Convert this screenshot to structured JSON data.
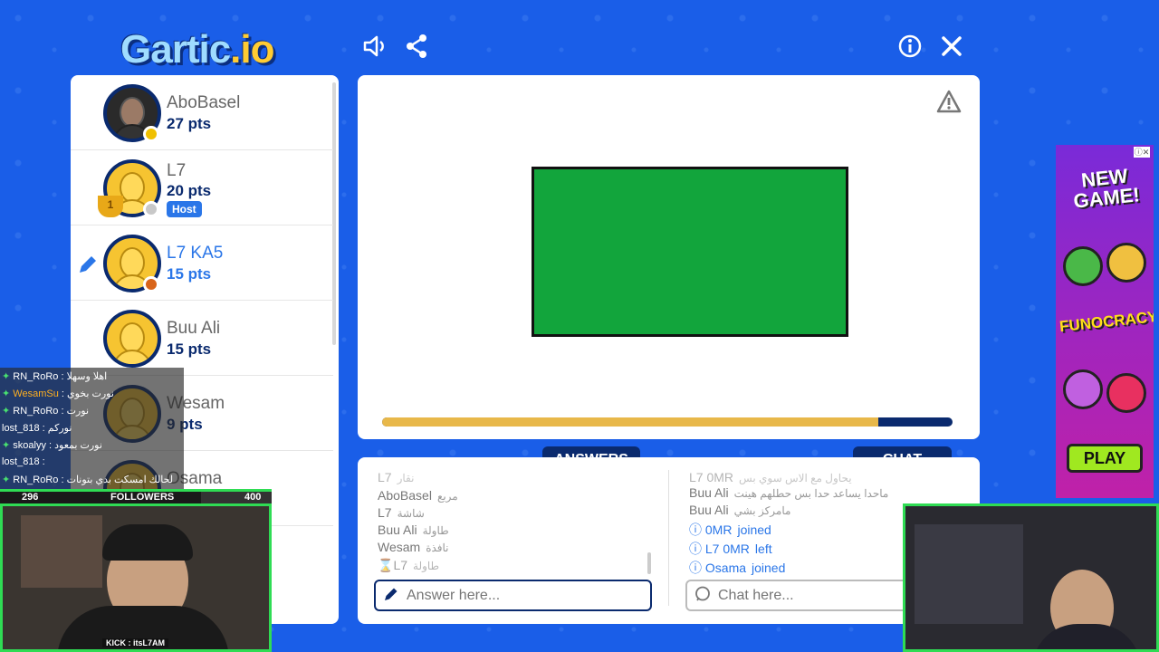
{
  "app": {
    "logo_text": "Gartic",
    "logo_suffix": ".io"
  },
  "header": {
    "sound_icon": "speaker-icon",
    "share_icon": "share-icon",
    "info_icon": "info-icon",
    "close_icon": "close-icon"
  },
  "players": [
    {
      "name": "AboBasel",
      "pts": "27 pts",
      "status_color": "#f0c000"
    },
    {
      "name": "L7",
      "pts": "20 pts",
      "status_color": "#c8c8c8",
      "host_label": "Host",
      "trophy": "1"
    },
    {
      "name": "L7 KA5",
      "pts": "15 pts",
      "status_color": "#d8641a"
    },
    {
      "name": "Buu Ali",
      "pts": "15 pts"
    },
    {
      "name": "Wesam",
      "pts": "9 pts"
    },
    {
      "name": "Osama",
      "pts": ""
    }
  ],
  "canvas": {
    "timer_fraction": 0.87,
    "shape_color": "#12a53c"
  },
  "tabs": {
    "answers": "ANSWERS",
    "chat": "CHAT"
  },
  "answers": [
    {
      "user": "L7",
      "text": "نقار"
    },
    {
      "user": "AboBasel",
      "text": "مربع"
    },
    {
      "user": "L7",
      "text": "شاشة"
    },
    {
      "user": "Buu Ali",
      "text": "طاولة"
    },
    {
      "user": "Wesam",
      "text": "نافذة"
    },
    {
      "user": "L7",
      "text": "طاولة"
    }
  ],
  "chat": [
    {
      "user": "L7 0MR",
      "text": "يحاول مع الاس سوي بس"
    },
    {
      "user": "Buu Ali",
      "text": "ماحدا يساعد حدا بس حطلهم هينت"
    },
    {
      "user": "Buu Ali",
      "text": "مامركز بشي"
    },
    {
      "user": "0MR",
      "text": "joined",
      "system": true
    },
    {
      "user": "L7 0MR",
      "text": "left",
      "system": true
    },
    {
      "user": "Osama",
      "text": "joined",
      "system": true
    }
  ],
  "inputs": {
    "answer_placeholder": "Answer here...",
    "chat_placeholder": "Chat here..."
  },
  "ad": {
    "headline": "NEW GAME!",
    "title": "FUNOCRACY",
    "play_label": "PLAY",
    "close_label": "ⓘ✕"
  },
  "stream_chat": [
    {
      "user": "RN_RoRo",
      "text": "اهلا وسهلا"
    },
    {
      "user": "WesamSu",
      "text": "نورت بخوي"
    },
    {
      "user": "RN_RoRo",
      "text": "نورت"
    },
    {
      "user": "lost_818",
      "text": "نوركم"
    },
    {
      "user": "skoalyy",
      "text": "نورت بمعود"
    },
    {
      "user": "lost_818",
      "text": ""
    },
    {
      "user": "RN_RoRo",
      "text": "لحالك امسكت بدي بتونات"
    }
  ],
  "followers": {
    "current": "296",
    "label": "FOLLOWERS",
    "goal": "400"
  },
  "cam": {
    "label": "KICK : itsL7AM"
  }
}
